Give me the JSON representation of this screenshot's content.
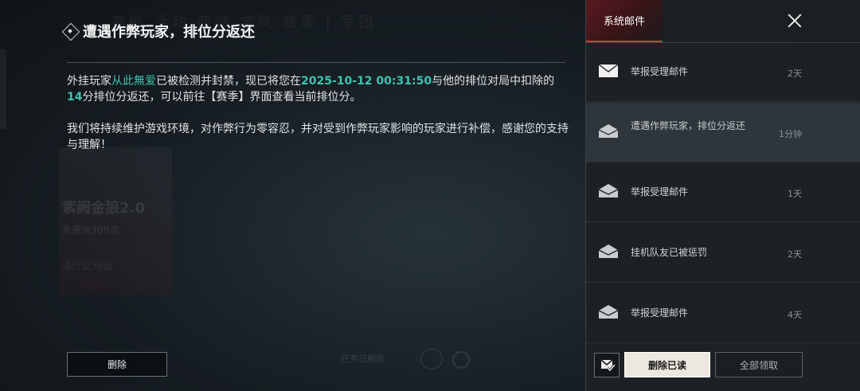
{
  "background": {
    "nav_text": "高能 活动 商城 学院 赛季 | 军团",
    "promo_title": "紫阙金狼2.0",
    "promo_sub": "免费送30R点",
    "promo_pass": "通行证36级",
    "bottom_status": "任务已刷新"
  },
  "detail": {
    "title": "遭遇作弊玩家，排位分返还",
    "body": {
      "p1_a": "外挂玩家",
      "p1_name": "从此無爱",
      "p1_b": "已被检测并封禁，现已将您在",
      "p1_time": "2025-10-12 00:31:50",
      "p1_c": "与他的排位对局中扣除的",
      "p1_points": "14",
      "p1_d": "分排位分返还，可以前往【赛季】界面查看当前排位分。",
      "p2": "我们将持续维护游戏环境，对作弊行为零容忍，并对受到作弊玩家影响的玩家进行补偿，感谢您的支持与理解！"
    },
    "delete_label": "删除"
  },
  "sidebar": {
    "tab_label": "系统邮件",
    "mails": [
      {
        "subject": "举报受理邮件",
        "time": "2天",
        "read": false,
        "selected": false
      },
      {
        "subject": "遭遇作弊玩家，排位分返还",
        "time": "1分钟",
        "read": true,
        "selected": true
      },
      {
        "subject": "举报受理邮件",
        "time": "1天",
        "read": true,
        "selected": false
      },
      {
        "subject": "挂机队友已被惩罚",
        "time": "2天",
        "read": true,
        "selected": false
      },
      {
        "subject": "举报受理邮件",
        "time": "4天",
        "read": true,
        "selected": false
      }
    ],
    "delete_read_label": "删除已读",
    "claim_all_label": "全部领取"
  },
  "colors": {
    "accent_teal": "#3fc3b0",
    "tab_red": "#d23a3a"
  }
}
